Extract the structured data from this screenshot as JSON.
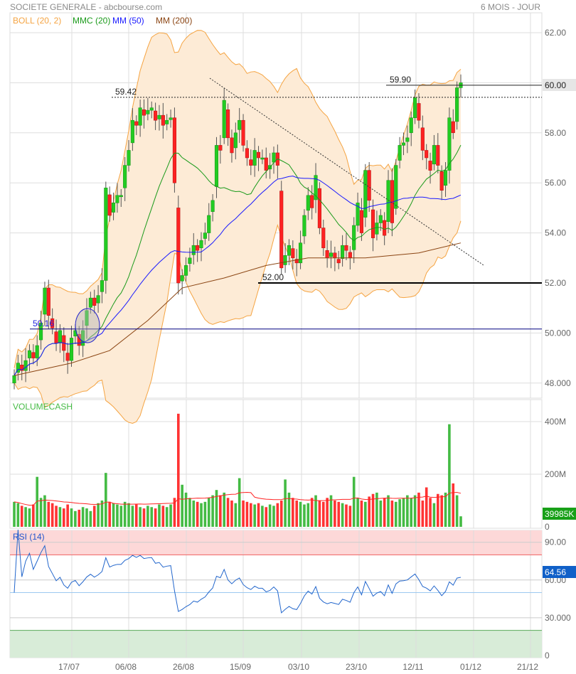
{
  "header": {
    "title": "SOCIETE GENERALE - abcbourse.com",
    "period": "6 MOIS - JOUR"
  },
  "legend": [
    {
      "label": "BOLL (20, 2)",
      "color": "#f5a442"
    },
    {
      "label": "MMC (20)",
      "color": "#1a9a1a"
    },
    {
      "label": "MM (50)",
      "color": "#1a1aff"
    },
    {
      "label": "MM (200)",
      "color": "#8b4513"
    }
  ],
  "colors": {
    "up": "#22cc22",
    "down": "#ff2222",
    "boll_fill": "#fdebd6",
    "grid": "#dddddd"
  },
  "chart_data": [
    {
      "type": "candlestick",
      "title": "SOCIETE GENERALE",
      "ylim": [
        47.5,
        63
      ],
      "yticks": [
        "62.00",
        "60.00",
        "58.00",
        "56.00",
        "54.00",
        "52.00",
        "50.000",
        "48.000"
      ],
      "ytick_values": [
        62,
        60,
        58,
        56,
        54,
        52,
        50,
        48
      ],
      "xticks": [
        "17/07",
        "06/08",
        "26/08",
        "15/09",
        "03/10",
        "23/10",
        "12/11",
        "01/12",
        "21/12"
      ],
      "last_price_label": "60.00",
      "closes": [
        48.3,
        48.8,
        48.5,
        48.9,
        49.3,
        49.0,
        49.5,
        50.4,
        51.8,
        50.7,
        50.2,
        49.6,
        50.1,
        49.3,
        48.9,
        49.8,
        50.1,
        49.5,
        50.1,
        50.9,
        51.4,
        51.1,
        51.5,
        52.1,
        55.8,
        54.7,
        55.2,
        55.5,
        55.5,
        56.7,
        57.3,
        58.5,
        58.3,
        59.0,
        58.7,
        58.9,
        59.0,
        58.5,
        58.7,
        58.3,
        58.5,
        58.6,
        56.0,
        52.0,
        52.3,
        52.7,
        53.0,
        53.5,
        53.3,
        53.7,
        54.0,
        54.7,
        55.3,
        57.5,
        57.3,
        59.3,
        57.8,
        57.2,
        58.0,
        58.5,
        57.5,
        57.0,
        56.7,
        57.3,
        57.0,
        57.0,
        56.5,
        56.7,
        57.2,
        56.7,
        52.6,
        53.1,
        53.5,
        53.0,
        52.8,
        53.6,
        54.7,
        55.5,
        55.0,
        56.3,
        54.2,
        53.4,
        53.0,
        53.2,
        53.0,
        52.8,
        53.5,
        53.3,
        53.0,
        54.3,
        55.2,
        54.0,
        56.5,
        55.3,
        53.8,
        54.4,
        54.7,
        53.9,
        56.1,
        54.4,
        56.7,
        57.5,
        57.6,
        57.8,
        58.6,
        59.4,
        58.5,
        57.3,
        57.0,
        56.5,
        57.5,
        56.7,
        55.7,
        56.5,
        58.6,
        58.0,
        59.8,
        60.0
      ],
      "mm200_anchors": [
        [
          0,
          48.3
        ],
        [
          15,
          48.8
        ],
        [
          25,
          49.3
        ],
        [
          35,
          50.5
        ],
        [
          44,
          51.8
        ],
        [
          55,
          52.2
        ],
        [
          66,
          52.7
        ],
        [
          77,
          53.0
        ],
        [
          92,
          53.0
        ],
        [
          106,
          53.2
        ],
        [
          117,
          53.6
        ]
      ],
      "annotations": [
        {
          "label": "59.42",
          "value": 59.42,
          "style": "dotted"
        },
        {
          "label": "59.90",
          "value": 59.9,
          "style": "solid"
        },
        {
          "label": "52.00",
          "value": 52.0,
          "style": "thick"
        },
        {
          "label": "50.16",
          "value": 50.16,
          "style": "navy"
        }
      ]
    },
    {
      "type": "bar",
      "title": "VOLUMECASH",
      "unit": "M",
      "ylim": [
        0,
        450
      ],
      "yticks": [
        "400M",
        "200M",
        "0"
      ],
      "ytick_values": [
        400,
        200,
        0
      ],
      "last_value_label": "39985K",
      "values": [
        95,
        90,
        80,
        75,
        70,
        85,
        190,
        110,
        120,
        95,
        90,
        80,
        75,
        70,
        85,
        70,
        60,
        65,
        75,
        70,
        60,
        80,
        90,
        100,
        205,
        95,
        90,
        85,
        80,
        95,
        90,
        80,
        85,
        75,
        70,
        80,
        75,
        70,
        85,
        80,
        75,
        85,
        110,
        430,
        160,
        130,
        110,
        100,
        95,
        90,
        95,
        110,
        120,
        140,
        120,
        130,
        110,
        100,
        90,
        185,
        100,
        95,
        90,
        85,
        90,
        80,
        75,
        85,
        80,
        90,
        100,
        180,
        130,
        110,
        100,
        95,
        85,
        90,
        110,
        120,
        100,
        95,
        110,
        120,
        100,
        95,
        90,
        85,
        80,
        190,
        110,
        100,
        95,
        115,
        125,
        130,
        100,
        110,
        120,
        100,
        95,
        105,
        110,
        120,
        110,
        120,
        130,
        100,
        150,
        110,
        90,
        125,
        120,
        130,
        390,
        165,
        120,
        40
      ]
    },
    {
      "type": "line",
      "title": "RSI (14)",
      "ylim": [
        0,
        100
      ],
      "yticks": [
        "90.00",
        "60.00",
        "30.000",
        "0"
      ],
      "ytick_values": [
        90,
        60,
        30,
        0
      ],
      "last_value_label": "64.56",
      "overbought": 80,
      "oversold": 20,
      "midline": 50
    }
  ]
}
